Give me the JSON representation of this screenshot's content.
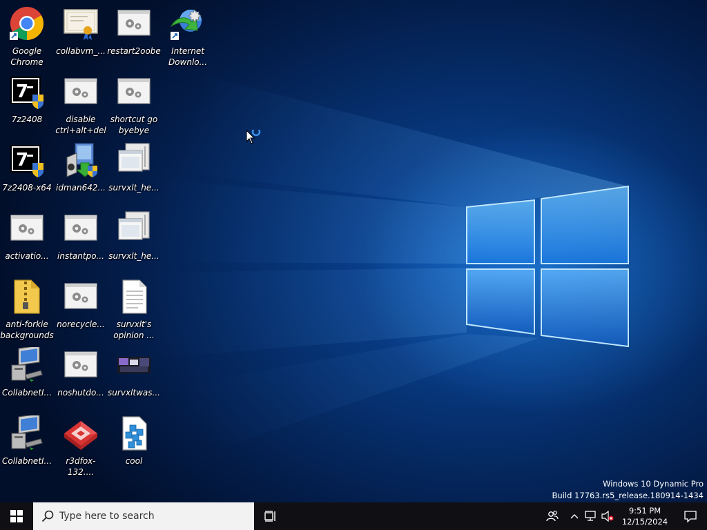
{
  "desktop": {
    "icons": [
      {
        "label": "Google\nChrome",
        "icon": "chrome-icon"
      },
      {
        "label": "collabvm_...",
        "icon": "certificate-icon"
      },
      {
        "label": "restart2oobe",
        "icon": "settings-file-icon"
      },
      {
        "label": "Internet\nDownlo...",
        "icon": "idm-icon"
      },
      {
        "label": "7z2408",
        "icon": "7zip-installer-icon"
      },
      {
        "label": "disable\nctrl+alt+del",
        "icon": "settings-file-icon"
      },
      {
        "label": "shortcut go\nbyebye",
        "icon": "settings-file-icon"
      },
      {
        "label": "7z2408-x64",
        "icon": "7zip-installer-icon"
      },
      {
        "label": "idman642...",
        "icon": "installer-icon"
      },
      {
        "label": "survxlt_he...",
        "icon": "window-file-icon"
      },
      {
        "label": "activatio...",
        "icon": "settings-file-icon"
      },
      {
        "label": "instantpo...",
        "icon": "settings-file-icon"
      },
      {
        "label": "survxlt_he...",
        "icon": "window-file-icon"
      },
      {
        "label": "anti-forkie\nbackgrounds",
        "icon": "zip-folder-icon"
      },
      {
        "label": "norecycle...",
        "icon": "settings-file-icon"
      },
      {
        "label": "survxlt's\nopinion ...",
        "icon": "text-document-icon"
      },
      {
        "label": "CollabnetI...",
        "icon": "network-computer-icon"
      },
      {
        "label": "noshutdo...",
        "icon": "settings-file-icon"
      },
      {
        "label": "survxltwas...",
        "icon": "image-thumbnail-icon"
      },
      {
        "label": "CollabnetI...",
        "icon": "network-computer-icon"
      },
      {
        "label": "r3dfox-132....",
        "icon": "r3dfox-icon"
      },
      {
        "label": "cool",
        "icon": "blue-blocks-icon"
      }
    ]
  },
  "watermark": {
    "line1": "Windows 10 Dynamic Pro",
    "line2": "Build 17763.rs5_release.180914-1434"
  },
  "taskbar": {
    "search_placeholder": "Type here to search",
    "clock_time": "9:51 PM",
    "clock_date": "12/15/2024"
  },
  "colors": {
    "taskbar": "#101014",
    "search_bg": "#f2f2f2",
    "wallpaper_blue": "#0b4ea8",
    "loading_ring": "#3a8ee6"
  }
}
